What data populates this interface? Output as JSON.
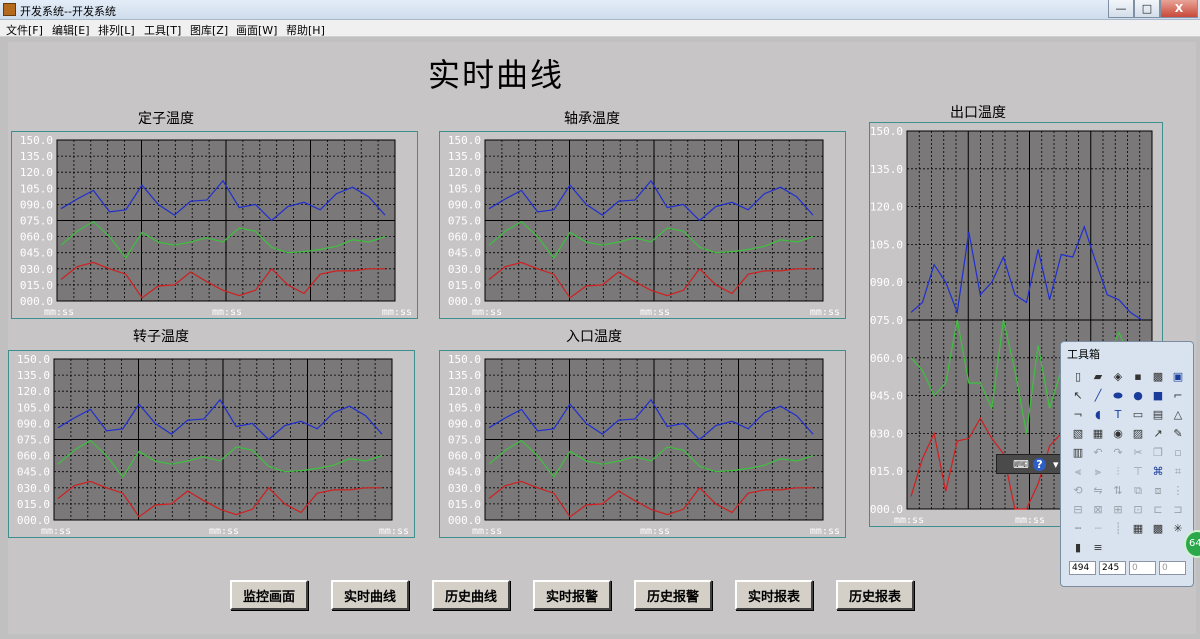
{
  "window": {
    "title": "开发系统--开发系统",
    "minimize_label": "—",
    "maximize_label": "□",
    "close_label": "X"
  },
  "menu": [
    "文件[F]",
    "编辑[E]",
    "排列[L]",
    "工具[T]",
    "图库[Z]",
    "画面[W]",
    "帮助[H]"
  ],
  "page_title": "实时曲线",
  "time_axis_label": "mm:ss",
  "colors": {
    "blue": "#1f2fd0",
    "green": "#3ec13e",
    "red": "#d11f1f",
    "plot_bg": "#7a7879",
    "frame": "#3f8f8f",
    "tick_text": "#ffffff"
  },
  "chart_data": [
    {
      "type": "line",
      "title": "定子温度",
      "ylim": [
        0,
        150
      ],
      "yticks": [
        "150.0",
        "135.0",
        "120.0",
        "105.0",
        "090.0",
        "075.0",
        "060.0",
        "045.0",
        "030.0",
        "015.0",
        "000.0"
      ],
      "x": [
        0,
        1,
        2,
        3,
        4,
        5,
        6,
        7,
        8,
        9,
        10,
        11,
        12,
        13,
        14,
        15,
        16,
        17,
        18,
        19,
        20
      ],
      "series": [
        {
          "color": "#1f2fd0",
          "values": [
            86,
            95,
            103,
            83,
            85,
            108,
            90,
            80,
            93,
            94,
            112,
            87,
            90,
            75,
            88,
            92,
            85,
            100,
            106,
            97,
            80
          ]
        },
        {
          "color": "#3ec13e",
          "values": [
            52,
            65,
            74,
            60,
            40,
            64,
            55,
            52,
            55,
            59,
            55,
            68,
            65,
            50,
            45,
            46,
            48,
            51,
            57,
            55,
            60
          ]
        },
        {
          "color": "#d11f1f",
          "values": [
            20,
            32,
            36,
            30,
            25,
            3,
            14,
            15,
            27,
            18,
            10,
            5,
            10,
            30,
            15,
            7,
            25,
            28,
            28,
            30,
            30
          ]
        }
      ]
    },
    {
      "type": "line",
      "title": "轴承温度",
      "ylim": [
        0,
        150
      ],
      "yticks": [
        "150.0",
        "135.0",
        "120.0",
        "105.0",
        "090.0",
        "075.0",
        "060.0",
        "045.0",
        "030.0",
        "015.0",
        "000.0"
      ],
      "x": [
        0,
        1,
        2,
        3,
        4,
        5,
        6,
        7,
        8,
        9,
        10,
        11,
        12,
        13,
        14,
        15,
        16,
        17,
        18,
        19,
        20
      ],
      "series": [
        {
          "color": "#1f2fd0",
          "values": [
            86,
            95,
            103,
            83,
            85,
            108,
            90,
            80,
            93,
            94,
            112,
            87,
            90,
            75,
            88,
            92,
            85,
            100,
            106,
            97,
            80
          ]
        },
        {
          "color": "#3ec13e",
          "values": [
            52,
            65,
            74,
            60,
            40,
            64,
            55,
            52,
            55,
            59,
            55,
            68,
            65,
            50,
            45,
            46,
            48,
            51,
            57,
            55,
            60
          ]
        },
        {
          "color": "#d11f1f",
          "values": [
            20,
            32,
            36,
            30,
            25,
            3,
            14,
            15,
            27,
            18,
            10,
            5,
            10,
            30,
            15,
            7,
            25,
            28,
            28,
            30,
            30
          ]
        }
      ]
    },
    {
      "type": "line",
      "title": "转子温度",
      "ylim": [
        0,
        150
      ],
      "yticks": [
        "150.0",
        "135.0",
        "120.0",
        "105.0",
        "090.0",
        "075.0",
        "060.0",
        "045.0",
        "030.0",
        "015.0",
        "000.0"
      ],
      "x": [
        0,
        1,
        2,
        3,
        4,
        5,
        6,
        7,
        8,
        9,
        10,
        11,
        12,
        13,
        14,
        15,
        16,
        17,
        18,
        19,
        20
      ],
      "series": [
        {
          "color": "#1f2fd0",
          "values": [
            86,
            95,
            103,
            83,
            85,
            108,
            90,
            80,
            93,
            94,
            112,
            87,
            90,
            75,
            88,
            92,
            85,
            100,
            106,
            97,
            80
          ]
        },
        {
          "color": "#3ec13e",
          "values": [
            52,
            65,
            74,
            60,
            40,
            64,
            55,
            52,
            55,
            59,
            55,
            68,
            65,
            50,
            45,
            46,
            48,
            51,
            57,
            55,
            60
          ]
        },
        {
          "color": "#d11f1f",
          "values": [
            20,
            32,
            36,
            30,
            25,
            3,
            14,
            15,
            27,
            18,
            10,
            5,
            10,
            30,
            15,
            7,
            25,
            28,
            28,
            30,
            30
          ]
        }
      ]
    },
    {
      "type": "line",
      "title": "入口温度",
      "ylim": [
        0,
        150
      ],
      "yticks": [
        "150.0",
        "135.0",
        "120.0",
        "105.0",
        "090.0",
        "075.0",
        "060.0",
        "045.0",
        "030.0",
        "015.0",
        "000.0"
      ],
      "x": [
        0,
        1,
        2,
        3,
        4,
        5,
        6,
        7,
        8,
        9,
        10,
        11,
        12,
        13,
        14,
        15,
        16,
        17,
        18,
        19,
        20
      ],
      "series": [
        {
          "color": "#1f2fd0",
          "values": [
            86,
            95,
            103,
            83,
            85,
            108,
            90,
            80,
            93,
            94,
            112,
            87,
            90,
            75,
            88,
            92,
            85,
            100,
            106,
            97,
            80
          ]
        },
        {
          "color": "#3ec13e",
          "values": [
            52,
            65,
            74,
            60,
            40,
            64,
            55,
            52,
            55,
            59,
            55,
            68,
            65,
            50,
            45,
            46,
            48,
            51,
            57,
            55,
            60
          ]
        },
        {
          "color": "#d11f1f",
          "values": [
            20,
            32,
            36,
            30,
            25,
            3,
            14,
            15,
            27,
            18,
            10,
            5,
            10,
            30,
            15,
            7,
            25,
            28,
            28,
            30,
            30
          ]
        }
      ]
    },
    {
      "type": "line",
      "title": "出口温度",
      "ylim": [
        0,
        150
      ],
      "yticks": [
        "150.0",
        "135.0",
        "120.0",
        "105.0",
        "090.0",
        "075.0",
        "060.0",
        "045.0",
        "030.0",
        "015.0",
        "000.0"
      ],
      "x": [
        0,
        1,
        2,
        3,
        4,
        5,
        6,
        7,
        8,
        9,
        10,
        11,
        12,
        13,
        14,
        15,
        16,
        17,
        18,
        19,
        20
      ],
      "series": [
        {
          "color": "#1f2fd0",
          "values": [
            78,
            82,
            97,
            90,
            78,
            110,
            85,
            90,
            100,
            85,
            82,
            103,
            83,
            101,
            100,
            112,
            98,
            85,
            83,
            78,
            75
          ]
        },
        {
          "color": "#3ec13e",
          "values": [
            60,
            55,
            45,
            50,
            75,
            50,
            50,
            40,
            75,
            55,
            30,
            65,
            40,
            55,
            60,
            65,
            66,
            60,
            70,
            60,
            55
          ]
        },
        {
          "color": "#d11f1f",
          "values": [
            5,
            20,
            30,
            7,
            27,
            28,
            36,
            28,
            22,
            0,
            0,
            10,
            25,
            30,
            35,
            20,
            25,
            30,
            30,
            28,
            25
          ]
        }
      ]
    }
  ],
  "nav_buttons": [
    "监控画面",
    "实时曲线",
    "历史曲线",
    "实时报警",
    "历史报警",
    "实时报表",
    "历史报表"
  ],
  "mini_toolbar": {
    "keyboard_label": "⌨",
    "help_label": "?",
    "menu_label": "▾"
  },
  "toolbox": {
    "title": "工具箱",
    "coords": [
      "494",
      "245",
      "0",
      "0"
    ],
    "badge": "64"
  }
}
